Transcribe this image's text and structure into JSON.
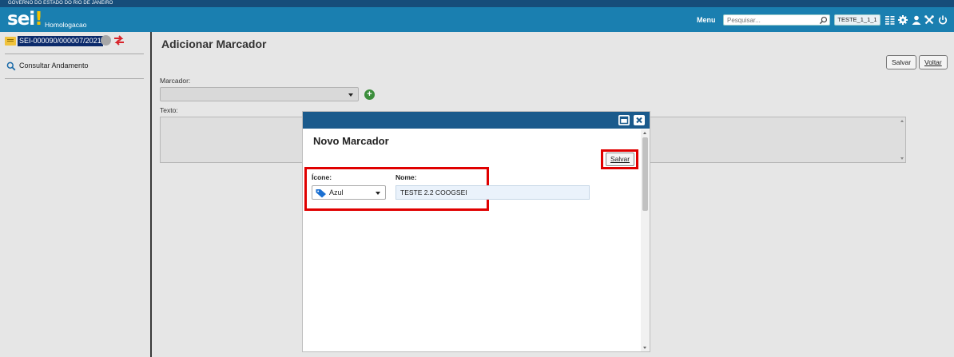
{
  "gov_strip": "GOVERNO DO ESTADO DO RIO DE JANEIRO",
  "header": {
    "logo": "sei",
    "logo_mark": "!",
    "environment": "Homologacao",
    "menu_label": "Menu",
    "search_placeholder": "Pesquisar...",
    "unit": "TESTE_1_1_1",
    "icons": [
      "search-icon",
      "list-icon",
      "gear-icon",
      "user-icon",
      "tools-icon",
      "power-icon"
    ]
  },
  "sidebar": {
    "process_number": "SEI-000090/000007/2021",
    "items": [
      {
        "label": "Consultar Andamento",
        "icon": "search-icon"
      }
    ]
  },
  "main": {
    "title": "Adicionar Marcador",
    "save_label": "Salvar",
    "back_label": "Voltar",
    "marker_label": "Marcador:",
    "text_label": "Texto:"
  },
  "modal": {
    "title": "Novo Marcador",
    "save_label": "Salvar",
    "icon_label": "Ícone:",
    "icon_value": "Azul",
    "name_label": "Nome:",
    "name_value": "TESTE 2.2 COOGSEI",
    "icon_color": "#1a6fd1"
  },
  "colors": {
    "header": "#1a7fb0",
    "gov_strip": "#164d7a",
    "modal_bar": "#1a5a8c",
    "highlight": "#e00000",
    "add_button": "#3c8e3c"
  }
}
